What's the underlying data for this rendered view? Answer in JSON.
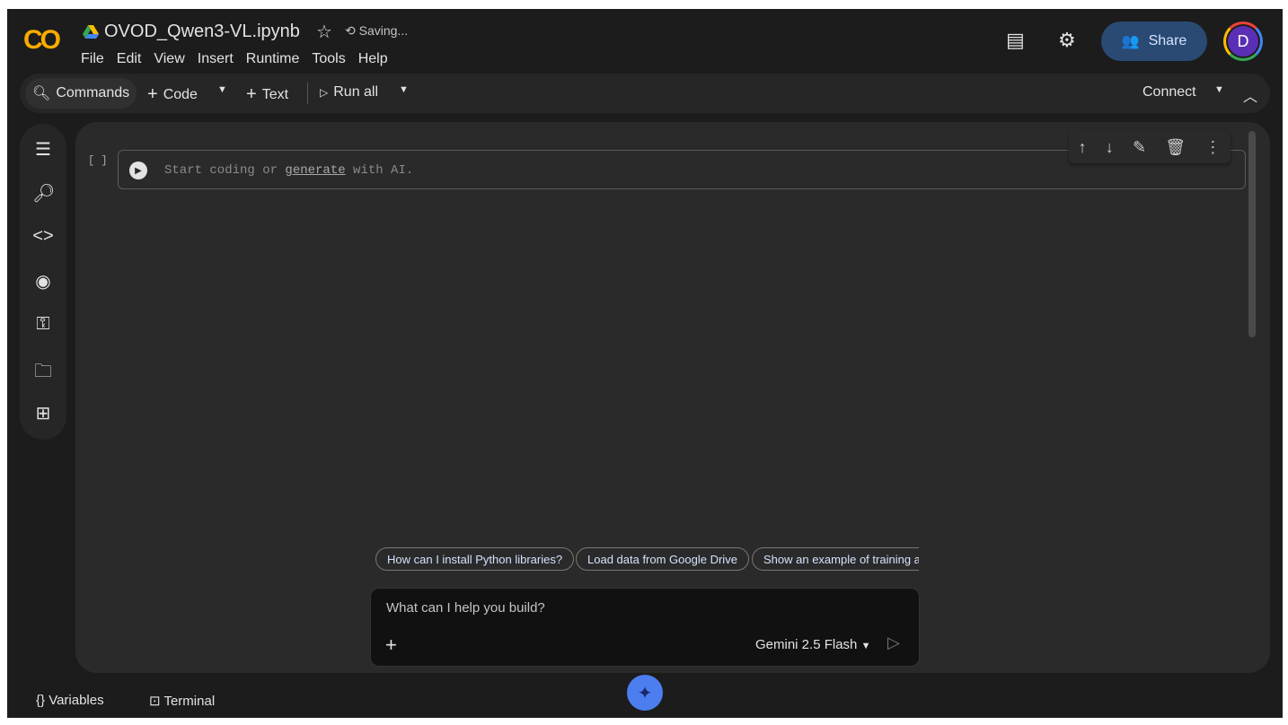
{
  "app": {
    "logo": "CO",
    "title": "OVOD_Qwen3-VL.ipynb",
    "status": "Saving...",
    "menu": [
      "File",
      "Edit",
      "View",
      "Insert",
      "Runtime",
      "Tools",
      "Help"
    ],
    "share": "Share",
    "avatar": "D"
  },
  "toolbar": {
    "commands": "Commands",
    "code": "Code",
    "text": "Text",
    "run_all": "Run all",
    "connect": "Connect"
  },
  "sidebar": {
    "icons": [
      "table-of-contents-icon",
      "find-icon",
      "code-snippets-icon",
      "variable-inspector-icon",
      "secrets-key-icon",
      "files-icon",
      "data-table-icon"
    ]
  },
  "cell": {
    "bracket": "[ ]",
    "placeholder_pre": "Start coding or ",
    "placeholder_link": "generate",
    "placeholder_post": " with AI."
  },
  "chips": [
    "How can I install Python libraries?",
    "Load data from Google Drive",
    "Show an example of training a"
  ],
  "chat": {
    "placeholder": "What can I help you build?",
    "model": "Gemini 2.5 Flash"
  },
  "bottom": {
    "variables": "Variables",
    "terminal": "Terminal"
  },
  "colors": {
    "accent": "#4c7ef0",
    "share_bg": "#2a4a73",
    "logo": "#f9ab00"
  }
}
